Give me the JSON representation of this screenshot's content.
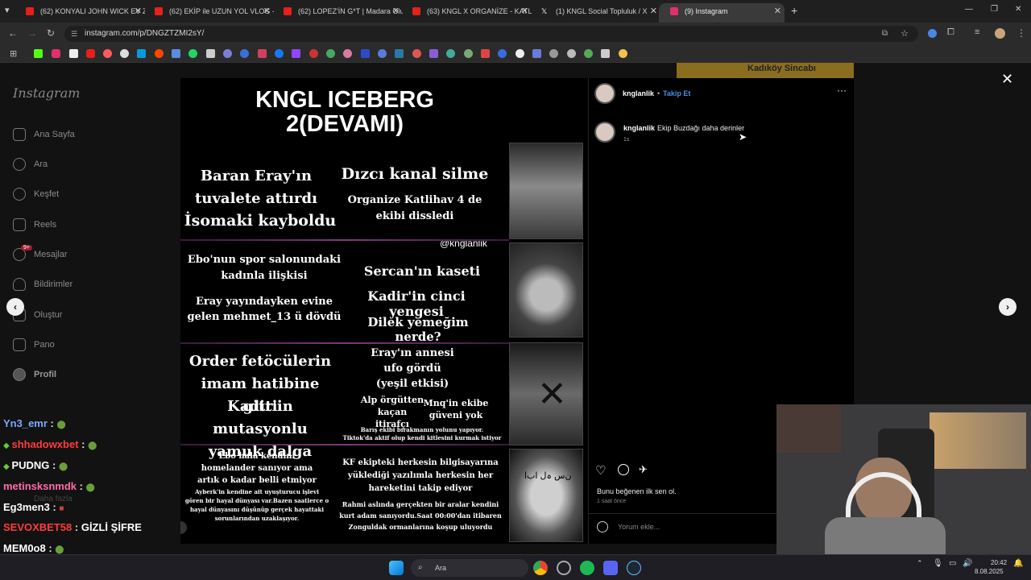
{
  "tabs": [
    {
      "label": "(62) KONYALI JOHN WICK EV ZİY",
      "color": "#e62117"
    },
    {
      "label": "(62) EKİP ile UZUN YOL VLOG -",
      "color": "#e62117"
    },
    {
      "label": "(62) LOPEZ'İN G*T | Madara Olu",
      "color": "#e62117"
    },
    {
      "label": "(63) KNGL X ORGANİZE - KATLİH",
      "color": "#e62117"
    },
    {
      "label": "(1) KNGL Social Topluluk / X",
      "color": "#ffffff"
    },
    {
      "label": "(9) Instagram",
      "color": "#e1306c"
    }
  ],
  "address": {
    "url": "instagram.com/p/DNGZTZMI2sY/"
  },
  "instagram": {
    "logo": "Instagram",
    "nav": [
      "Ana Sayfa",
      "Ara",
      "Keşfet",
      "Reels",
      "Mesajlar",
      "Bildirimler",
      "Oluştur",
      "Pano",
      "Profil"
    ],
    "nav_icons": [
      "home-icon",
      "search-icon",
      "compass-icon",
      "reels-icon",
      "messages-icon",
      "heart-icon",
      "plus-icon",
      "dashboard-icon",
      "profile-icon"
    ],
    "messages_badge": "9+",
    "more": "Daha fazla",
    "post": {
      "title": "KNGL ICEBERG\n2(DEVAMI)",
      "watermark": "@knglanlik",
      "texts": {
        "a": "Baran Eray'ın\ntuvalete attırdı",
        "b": "İsomaki kayboldu",
        "c": "Dızcı kanal silme",
        "d": "Organize Katlihav 4 de\nekibi dissledi",
        "e": "Ebo'nun spor salonundaki\nkadınla ilişkisi",
        "f": "Sercan'ın kaseti",
        "g": "Eray yayındayken evine\ngelen mehmet_13 ü dövdü",
        "h": "Kadir'in cinci yengesi",
        "i": "Dilek yemeğim nerde?",
        "j": "Order fetöcülerin\nimam hatibine gitti",
        "k": "Kadir'in mutasyonlu\nyamuk dalga",
        "l": "Eray'ın annesi\nufo gördü\n(yeşil etkisi)",
        "m": "Alp örgütten\nkaçan itirafçı",
        "n": "Mnq'in ekibe\ngüveni yok",
        "o": "Barış ekibi bırakmanın yolunu yapıyor.\nTiktok'da aktif olup kendi kitlesini kurmak istiyor",
        "p": "Ebo hala kendini\nhomelander sanıyor ama\nartık o kadar belli etmiyor",
        "q": "Ayberk'in kendine ait uyuşturucu işlevi\ngören bir hayal dünyası var.Bazen saatlerce o\nhayal dünyasını düşünüp gerçek hayattaki\nsorunlarından uzaklaşıyor.",
        "r": "KF ekipteki herkesin bilgisayarına\nyüklediği yazılımla herkesin her\nhareketini takip ediyor",
        "s": "Rahmi aslında gerçekten bir aralar kendini\nkurt adam sanıyordu.Saat 00:00'dan itibaren\nZonguldak ormanlarına koşup uluyordu"
      },
      "face_caption": "ن‌س ‌ہ‌ل ‌اب‌ا"
    },
    "panel": {
      "username": "knglanlik",
      "dot": "•",
      "follow": "Takip Et",
      "caption_user": "knglanlik",
      "caption_text": "Ekip Buzdağı daha derinler",
      "caption_time": "1s",
      "likes": "Bunu beğenen ilk sen ol.",
      "post_time": "1 saat önce",
      "comment_placeholder": "Yorum ekle..."
    },
    "background_label": "Kadıköy Sincabı"
  },
  "chat": [
    {
      "user": "Yn3_emr",
      "color": "#7fa7ff",
      "sep": " : ",
      "msg": ""
    },
    {
      "user": "shhadowxbet",
      "color": "#ff3c3c",
      "sep": " : ",
      "msg": ""
    },
    {
      "user": "PUDNG",
      "color": "#ffffff",
      "sep": " : ",
      "msg": ""
    },
    {
      "user": "metinsksnmdk",
      "color": "#ff6ba6",
      "sep": " : ",
      "msg": ""
    },
    {
      "user": "Eg3men3",
      "color": "#ffffff",
      "sep": " : ",
      "msg": ""
    },
    {
      "user": "SEVOXBET58",
      "color": "#ff3c3c",
      "sep": " : ",
      "msg": "GİZLİ ŞİFRE"
    },
    {
      "user": "MEM0o8",
      "color": "#ffffff",
      "sep": " : ",
      "msg": ""
    }
  ],
  "taskbar": {
    "search": "Ara",
    "time": "20:42",
    "date": "8.08.2025"
  }
}
